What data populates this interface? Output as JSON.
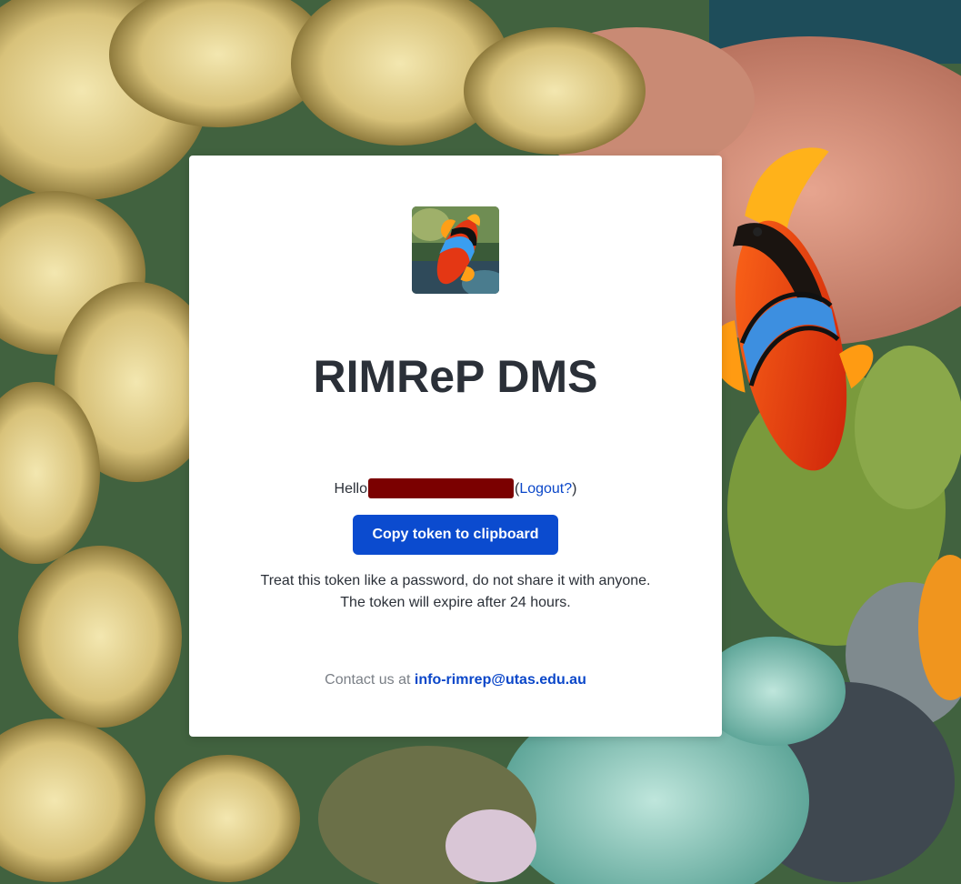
{
  "app": {
    "title": "RIMReP DMS"
  },
  "greeting": {
    "hello_label": "Hello",
    "open_paren": "(",
    "logout_label": "Logout?",
    "close_paren": ")"
  },
  "actions": {
    "copy_token_label": "Copy token to clipboard"
  },
  "notice": {
    "line1": "Treat this token like a password, do not share it with anyone.",
    "line2": "The token will expire after 24 hours."
  },
  "footer": {
    "contact_prefix": "Contact us at",
    "contact_email": "info-rimrep@utas.edu.au"
  },
  "colors": {
    "accent": "#0b4bcf",
    "link": "#0b47c9",
    "redaction": "#7b0000",
    "text": "#2b3038"
  },
  "icons": {
    "logo": "clownfish-logo-icon"
  }
}
